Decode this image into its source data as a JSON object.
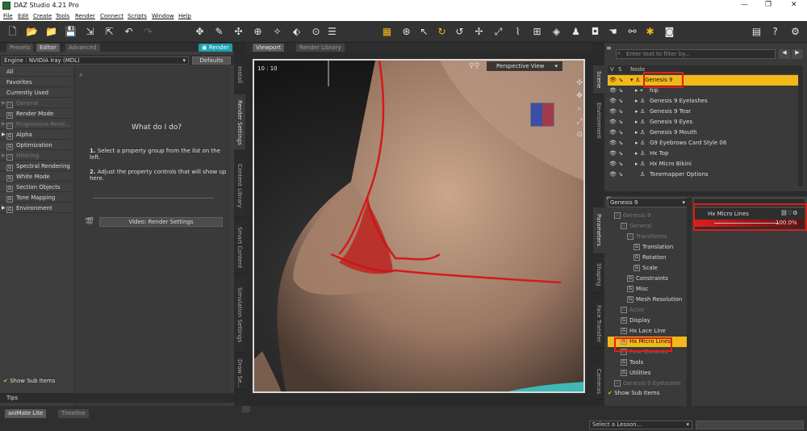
{
  "window": {
    "title": "DAZ Studio 4.21 Pro"
  },
  "menu": [
    "File",
    "Edit",
    "Create",
    "Tools",
    "Render",
    "Connect",
    "Scripts",
    "Window",
    "Help"
  ],
  "left_tabs": [
    "Presets",
    "Editor",
    "Advanced"
  ],
  "render_tab": "Render",
  "engine": {
    "label": "Engine :",
    "value": "NVIDIA Iray (MDL)",
    "defaults": "Defaults"
  },
  "categories": [
    {
      "label": "All",
      "grey": false,
      "icon": false
    },
    {
      "label": "Favorites",
      "grey": false,
      "icon": false
    },
    {
      "label": "Currently Used",
      "grey": false,
      "icon": false
    },
    {
      "label": "General",
      "grey": true,
      "icon": true,
      "expand": true
    },
    {
      "label": "Render Mode",
      "grey": false,
      "icon": true
    },
    {
      "label": "Progressive Rend...",
      "grey": true,
      "icon": true,
      "expand": true
    },
    {
      "label": "Alpha",
      "grey": false,
      "icon": true,
      "expand": true
    },
    {
      "label": "Optimization",
      "grey": false,
      "icon": true
    },
    {
      "label": "Filtering",
      "grey": true,
      "icon": true,
      "expand": true
    },
    {
      "label": "Spectral Rendering",
      "grey": false,
      "icon": true
    },
    {
      "label": "White Mode",
      "grey": false,
      "icon": true
    },
    {
      "label": "Section Objects",
      "grey": false,
      "icon": true
    },
    {
      "label": "Tone Mapping",
      "grey": false,
      "icon": true
    },
    {
      "label": "Environment",
      "grey": false,
      "icon": true,
      "expand": true
    }
  ],
  "help": {
    "title": "What do I do?",
    "step1": "Select a property group from the list on the left.",
    "step2": "Adjust the property controls that will show up here.",
    "video": "Video: Render Settings"
  },
  "show_sub_items": "Show Sub Items",
  "tips": "Tips",
  "left_side_tabs": [
    "Install",
    "Render Settings",
    "Content Library",
    "Smart Content",
    "Simulation Settings",
    "Draw Se..."
  ],
  "viewport": {
    "tabs": [
      "Viewport",
      "Render Library"
    ],
    "view": "Perspective View",
    "frame": "10 : 10"
  },
  "scene": {
    "filter_placeholder": "Enter text to filter by...",
    "headers": [
      "V",
      "S",
      "Node"
    ],
    "nodes": [
      "Genesis 9",
      "hip",
      "Genesis 9 Eyelashes",
      "Genesis 9 Tear",
      "Genesis 9 Eyes",
      "Genesis 9 Mouth",
      "G9 Eyebrows Card Style 06",
      "Hx Top",
      "Hx Micro Bikini",
      "Tonemapper Options"
    ]
  },
  "right_side_tabs": [
    "Scene",
    "Environment",
    "Parameters",
    "Shaping",
    "Face Transfer",
    "Cameras"
  ],
  "params": {
    "node": "Genesis 9",
    "tree": [
      {
        "label": "Genesis 9",
        "grey": true
      },
      {
        "label": "General",
        "grey": true
      },
      {
        "label": "Transforms",
        "grey": true
      },
      {
        "label": "Translation",
        "grey": false
      },
      {
        "label": "Rotation",
        "grey": false
      },
      {
        "label": "Scale",
        "grey": false
      },
      {
        "label": "Constraints",
        "grey": false
      },
      {
        "label": "Misc",
        "grey": false
      },
      {
        "label": "Mesh Resolution",
        "grey": false
      },
      {
        "label": "Actor",
        "grey": true
      },
      {
        "label": "Display",
        "grey": false
      },
      {
        "label": "Hx Lace Line",
        "grey": false
      },
      {
        "label": "Hx Micro Lines",
        "grey": false
      },
      {
        "label": "Pose Controls",
        "grey": true
      },
      {
        "label": "Tools",
        "grey": false
      },
      {
        "label": "Utilities",
        "grey": false
      },
      {
        "label": "Genesis 9 Eyelashes",
        "grey": true
      }
    ],
    "show_sub_items": "Show Sub Items",
    "prop_label": "Hx Micro Lines",
    "prop_value": "100.0%",
    "prop_fill": 1.0
  },
  "bottom": {
    "tabs": [
      "aniMate Lite",
      "Timeline"
    ],
    "lesson": "Select a Lesson..."
  }
}
